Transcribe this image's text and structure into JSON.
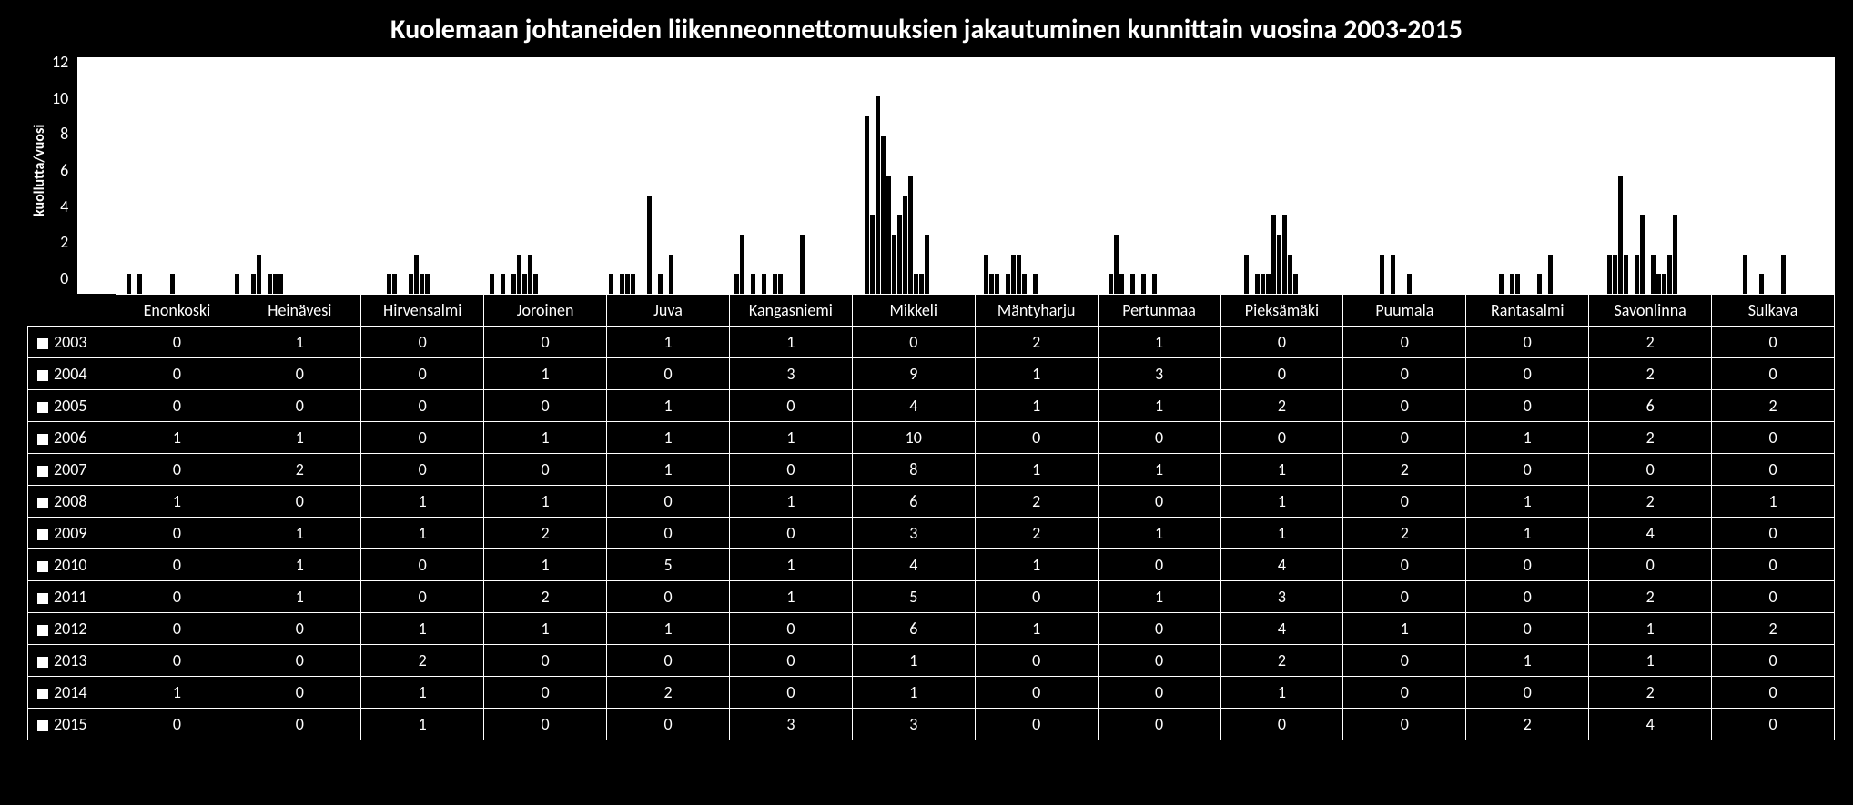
{
  "title": "Kuolemaan johtaneiden liikenneonnettomuuksien jakautuminen kunnittain vuosina 2003-2015",
  "ylabel": "kuollutta/vuosi",
  "yticks": [
    "12",
    "10",
    "8",
    "6",
    "4",
    "2",
    "0"
  ],
  "categories": [
    "Enonkoski",
    "Heinävesi",
    "Hirvensalmi",
    "Joroinen",
    "Juva",
    "Kangasniemi",
    "Mikkeli",
    "Mäntyharju",
    "Pertunmaa",
    "Pieksämäki",
    "Puumala",
    "Rantasalmi",
    "Savonlinna",
    "Sulkava"
  ],
  "series": [
    {
      "name": "2003",
      "values": [
        0,
        1,
        0,
        0,
        1,
        1,
        0,
        2,
        1,
        0,
        0,
        0,
        2,
        0
      ]
    },
    {
      "name": "2004",
      "values": [
        0,
        0,
        0,
        1,
        0,
        3,
        9,
        1,
        3,
        0,
        0,
        0,
        2,
        0
      ]
    },
    {
      "name": "2005",
      "values": [
        0,
        0,
        0,
        0,
        1,
        0,
        4,
        1,
        1,
        2,
        0,
        0,
        6,
        2
      ]
    },
    {
      "name": "2006",
      "values": [
        1,
        1,
        0,
        1,
        1,
        1,
        10,
        0,
        0,
        0,
        0,
        1,
        2,
        0
      ]
    },
    {
      "name": "2007",
      "values": [
        0,
        2,
        0,
        0,
        1,
        0,
        8,
        1,
        1,
        1,
        2,
        0,
        0,
        0
      ]
    },
    {
      "name": "2008",
      "values": [
        1,
        0,
        1,
        1,
        0,
        1,
        6,
        2,
        0,
        1,
        0,
        1,
        2,
        1
      ]
    },
    {
      "name": "2009",
      "values": [
        0,
        1,
        1,
        2,
        0,
        0,
        3,
        2,
        1,
        1,
        2,
        1,
        4,
        0
      ]
    },
    {
      "name": "2010",
      "values": [
        0,
        1,
        0,
        1,
        5,
        1,
        4,
        1,
        0,
        4,
        0,
        0,
        0,
        0
      ]
    },
    {
      "name": "2011",
      "values": [
        0,
        1,
        0,
        2,
        0,
        1,
        5,
        0,
        1,
        3,
        0,
        0,
        2,
        0
      ]
    },
    {
      "name": "2012",
      "values": [
        0,
        0,
        1,
        1,
        1,
        0,
        6,
        1,
        0,
        4,
        1,
        0,
        1,
        2
      ]
    },
    {
      "name": "2013",
      "values": [
        0,
        0,
        2,
        0,
        0,
        0,
        1,
        0,
        0,
        2,
        0,
        1,
        1,
        0
      ]
    },
    {
      "name": "2014",
      "values": [
        1,
        0,
        1,
        0,
        2,
        0,
        1,
        0,
        0,
        1,
        0,
        0,
        2,
        0
      ]
    },
    {
      "name": "2015",
      "values": [
        0,
        0,
        1,
        0,
        0,
        3,
        3,
        0,
        0,
        0,
        0,
        2,
        4,
        0
      ]
    }
  ],
  "chart_data": {
    "type": "bar",
    "title": "Kuolemaan johtaneiden liikenneonnettomuuksien jakautuminen kunnittain vuosina 2003-2015",
    "xlabel": "",
    "ylabel": "kuollutta/vuosi",
    "ylim": [
      0,
      12
    ],
    "categories": [
      "Enonkoski",
      "Heinävesi",
      "Hirvensalmi",
      "Joroinen",
      "Juva",
      "Kangasniemi",
      "Mikkeli",
      "Mäntyharju",
      "Pertunmaa",
      "Pieksämäki",
      "Puumala",
      "Rantasalmi",
      "Savonlinna",
      "Sulkava"
    ],
    "series": [
      {
        "name": "2003",
        "values": [
          0,
          1,
          0,
          0,
          1,
          1,
          0,
          2,
          1,
          0,
          0,
          0,
          2,
          0
        ]
      },
      {
        "name": "2004",
        "values": [
          0,
          0,
          0,
          1,
          0,
          3,
          9,
          1,
          3,
          0,
          0,
          0,
          2,
          0
        ]
      },
      {
        "name": "2005",
        "values": [
          0,
          0,
          0,
          0,
          1,
          0,
          4,
          1,
          1,
          2,
          0,
          0,
          6,
          2
        ]
      },
      {
        "name": "2006",
        "values": [
          1,
          1,
          0,
          1,
          1,
          1,
          10,
          0,
          0,
          0,
          0,
          1,
          2,
          0
        ]
      },
      {
        "name": "2007",
        "values": [
          0,
          2,
          0,
          0,
          1,
          0,
          8,
          1,
          1,
          1,
          2,
          0,
          0,
          0
        ]
      },
      {
        "name": "2008",
        "values": [
          1,
          0,
          1,
          1,
          0,
          1,
          6,
          2,
          0,
          1,
          0,
          1,
          2,
          1
        ]
      },
      {
        "name": "2009",
        "values": [
          0,
          1,
          1,
          2,
          0,
          0,
          3,
          2,
          1,
          1,
          2,
          1,
          4,
          0
        ]
      },
      {
        "name": "2010",
        "values": [
          0,
          1,
          0,
          1,
          5,
          1,
          4,
          1,
          0,
          4,
          0,
          0,
          0,
          0
        ]
      },
      {
        "name": "2011",
        "values": [
          0,
          1,
          0,
          2,
          0,
          1,
          5,
          0,
          1,
          3,
          0,
          0,
          2,
          0
        ]
      },
      {
        "name": "2012",
        "values": [
          0,
          0,
          1,
          1,
          1,
          0,
          6,
          1,
          0,
          4,
          1,
          0,
          1,
          2
        ]
      },
      {
        "name": "2013",
        "values": [
          0,
          0,
          2,
          0,
          0,
          0,
          1,
          0,
          0,
          2,
          0,
          1,
          1,
          0
        ]
      },
      {
        "name": "2014",
        "values": [
          1,
          0,
          1,
          0,
          2,
          0,
          1,
          0,
          0,
          1,
          0,
          0,
          2,
          0
        ]
      },
      {
        "name": "2015",
        "values": [
          0,
          0,
          1,
          0,
          0,
          3,
          3,
          0,
          0,
          0,
          0,
          2,
          4,
          0
        ]
      }
    ],
    "legend_position": "below (as data table)",
    "grid": false
  }
}
